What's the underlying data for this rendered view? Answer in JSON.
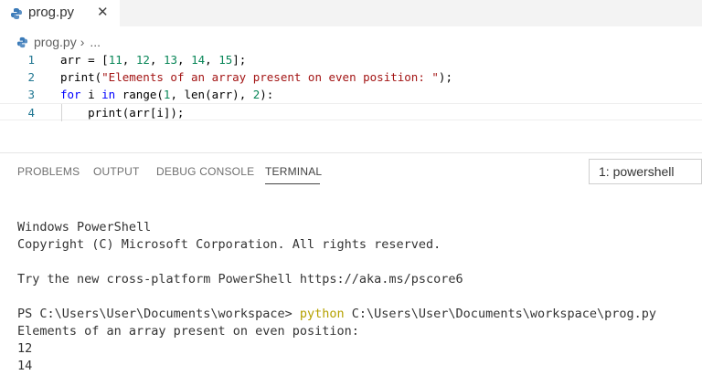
{
  "tab": {
    "title": "prog.py",
    "close_glyph": "✕",
    "icon": "python-icon"
  },
  "breadcrumb": {
    "file": "prog.py",
    "separator": "›",
    "more": "..."
  },
  "editor": {
    "lines": [
      {
        "number": "1",
        "tokens": [
          {
            "t": "arr = [",
            "c": "ident"
          },
          {
            "t": "11",
            "c": "num"
          },
          {
            "t": ", ",
            "c": "ident"
          },
          {
            "t": "12",
            "c": "num"
          },
          {
            "t": ", ",
            "c": "ident"
          },
          {
            "t": "13",
            "c": "num"
          },
          {
            "t": ", ",
            "c": "ident"
          },
          {
            "t": "14",
            "c": "num"
          },
          {
            "t": ", ",
            "c": "ident"
          },
          {
            "t": "15",
            "c": "num"
          },
          {
            "t": "];",
            "c": "ident"
          }
        ]
      },
      {
        "number": "2",
        "tokens": [
          {
            "t": "print(",
            "c": "ident"
          },
          {
            "t": "\"Elements of an array present on even position: \"",
            "c": "str"
          },
          {
            "t": ");",
            "c": "ident"
          }
        ]
      },
      {
        "number": "3",
        "tokens": [
          {
            "t": "for",
            "c": "kw"
          },
          {
            "t": " i ",
            "c": "ident"
          },
          {
            "t": "in",
            "c": "kw"
          },
          {
            "t": " range(",
            "c": "ident"
          },
          {
            "t": "1",
            "c": "num"
          },
          {
            "t": ", len(arr), ",
            "c": "ident"
          },
          {
            "t": "2",
            "c": "num"
          },
          {
            "t": "):",
            "c": "ident"
          }
        ]
      },
      {
        "number": "4",
        "tokens": [
          {
            "t": "    print(arr[i]);",
            "c": "ident"
          }
        ]
      }
    ]
  },
  "panel": {
    "tabs": [
      "PROBLEMS",
      "OUTPUT",
      "DEBUG CONSOLE",
      "TERMINAL"
    ],
    "active_tab": "TERMINAL",
    "terminal_select": "1: powershell"
  },
  "terminal": {
    "lines": [
      "Windows PowerShell",
      "Copyright (C) Microsoft Corporation. All rights reserved.",
      "",
      "Try the new cross-platform PowerShell https://aka.ms/pscore6",
      "",
      "",
      "Elements of an array present on even position:",
      "12",
      "14"
    ],
    "prompt": "PS C:\\Users\\User\\Documents\\workspace> ",
    "command": "python",
    "command_args": " C:\\Users\\User\\Documents\\workspace\\prog.py"
  },
  "colors": {
    "keyword": "#0000ff",
    "string": "#a31515",
    "number": "#098658",
    "line_number": "#237893",
    "command": "#b5a100"
  }
}
